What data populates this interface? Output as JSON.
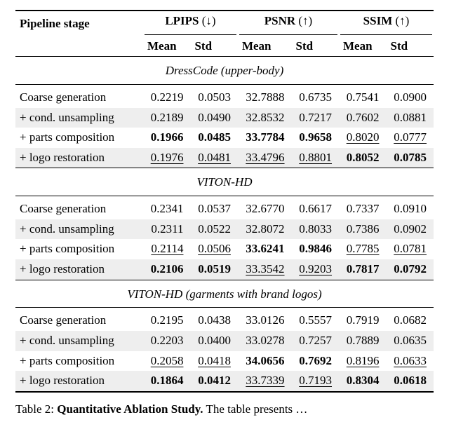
{
  "chart_data": {
    "type": "table",
    "title": "Table 2: Quantitative Ablation Study",
    "columns": [
      "Pipeline stage",
      "LPIPS Mean",
      "LPIPS Std",
      "PSNR Mean",
      "PSNR Std",
      "SSIM Mean",
      "SSIM Std"
    ],
    "sections": [
      {
        "name": "DressCode (upper-body)",
        "rows": [
          [
            "Coarse generation",
            0.2219,
            0.0503,
            32.7888,
            0.6735,
            0.7541,
            0.09
          ],
          [
            "+ cond. unsampling",
            0.2189,
            0.049,
            32.8532,
            0.7217,
            0.7602,
            0.0881
          ],
          [
            "+ parts composition",
            0.1966,
            0.0485,
            33.7784,
            0.9658,
            0.802,
            0.0777
          ],
          [
            "+ logo restoration",
            0.1976,
            0.0481,
            33.4796,
            0.8801,
            0.8052,
            0.0785
          ]
        ]
      },
      {
        "name": "VITON-HD",
        "rows": [
          [
            "Coarse generation",
            0.2341,
            0.0537,
            32.677,
            0.6617,
            0.7337,
            0.091
          ],
          [
            "+ cond. unsampling",
            0.2311,
            0.0522,
            32.8072,
            0.8033,
            0.7386,
            0.0902
          ],
          [
            "+ parts composition",
            0.2114,
            0.0506,
            33.6241,
            0.9846,
            0.7785,
            0.0781
          ],
          [
            "+ logo restoration",
            0.2106,
            0.0519,
            33.3542,
            0.9203,
            0.7817,
            0.0792
          ]
        ]
      },
      {
        "name": "VITON-HD (garments with brand logos)",
        "rows": [
          [
            "Coarse generation",
            0.2195,
            0.0438,
            33.0126,
            0.5557,
            0.7919,
            0.0682
          ],
          [
            "+ cond. unsampling",
            0.2203,
            0.04,
            33.0278,
            0.7257,
            0.7889,
            0.0635
          ],
          [
            "+ parts composition",
            0.2058,
            0.0418,
            34.0656,
            0.7692,
            0.8196,
            0.0633
          ],
          [
            "+ logo restoration",
            0.1864,
            0.0412,
            33.7339,
            0.7193,
            0.8304,
            0.0618
          ]
        ]
      }
    ]
  },
  "header": {
    "pipeline": "Pipeline stage",
    "lpips": "LPIPS",
    "lpips_arrow": "(↓)",
    "psnr": "PSNR",
    "psnr_arrow": "(↑)",
    "ssim": "SSIM",
    "ssim_arrow": "(↑)",
    "mean": "Mean",
    "std": "Std"
  },
  "sections": {
    "s0": {
      "title": "DressCode (upper-body)",
      "r0": {
        "stage": "Coarse generation",
        "lm": "0.2219",
        "ls": "0.0503",
        "pm": "32.7888",
        "ps": "0.6735",
        "sm": "0.7541",
        "ss": "0.0900"
      },
      "r1": {
        "stage": "+ cond. unsampling",
        "lm": "0.2189",
        "ls": "0.0490",
        "pm": "32.8532",
        "ps": "0.7217",
        "sm": "0.7602",
        "ss": "0.0881"
      },
      "r2": {
        "stage": "+ parts composition",
        "lm": "0.1966",
        "ls": "0.0485",
        "pm": "33.7784",
        "ps": "0.9658",
        "sm": "0.8020",
        "ss": "0.0777"
      },
      "r3": {
        "stage": "+ logo restoration",
        "lm": "0.1976",
        "ls": "0.0481",
        "pm": "33.4796",
        "ps": "0.8801",
        "sm": "0.8052",
        "ss": "0.0785"
      }
    },
    "s1": {
      "title": "VITON-HD",
      "r0": {
        "stage": "Coarse generation",
        "lm": "0.2341",
        "ls": "0.0537",
        "pm": "32.6770",
        "ps": "0.6617",
        "sm": "0.7337",
        "ss": "0.0910"
      },
      "r1": {
        "stage": "+ cond. unsampling",
        "lm": "0.2311",
        "ls": "0.0522",
        "pm": "32.8072",
        "ps": "0.8033",
        "sm": "0.7386",
        "ss": "0.0902"
      },
      "r2": {
        "stage": "+ parts composition",
        "lm": "0.2114",
        "ls": "0.0506",
        "pm": "33.6241",
        "ps": "0.9846",
        "sm": "0.7785",
        "ss": "0.0781"
      },
      "r3": {
        "stage": "+ logo restoration",
        "lm": "0.2106",
        "ls": "0.0519",
        "pm": "33.3542",
        "ps": "0.9203",
        "sm": "0.7817",
        "ss": "0.0792"
      }
    },
    "s2": {
      "title": "VITON-HD (garments with brand logos)",
      "r0": {
        "stage": "Coarse generation",
        "lm": "0.2195",
        "ls": "0.0438",
        "pm": "33.0126",
        "ps": "0.5557",
        "sm": "0.7919",
        "ss": "0.0682"
      },
      "r1": {
        "stage": "+ cond. unsampling",
        "lm": "0.2203",
        "ls": "0.0400",
        "pm": "33.0278",
        "ps": "0.7257",
        "sm": "0.7889",
        "ss": "0.0635"
      },
      "r2": {
        "stage": "+ parts composition",
        "lm": "0.2058",
        "ls": "0.0418",
        "pm": "34.0656",
        "ps": "0.7692",
        "sm": "0.8196",
        "ss": "0.0633"
      },
      "r3": {
        "stage": "+ logo restoration",
        "lm": "0.1864",
        "ls": "0.0412",
        "pm": "33.7339",
        "ps": "0.7193",
        "sm": "0.8304",
        "ss": "0.0618"
      }
    }
  },
  "caption": {
    "tabno": "Table 2: ",
    "title": "Quantitative Ablation Study.",
    "rest": " The table presents …"
  }
}
